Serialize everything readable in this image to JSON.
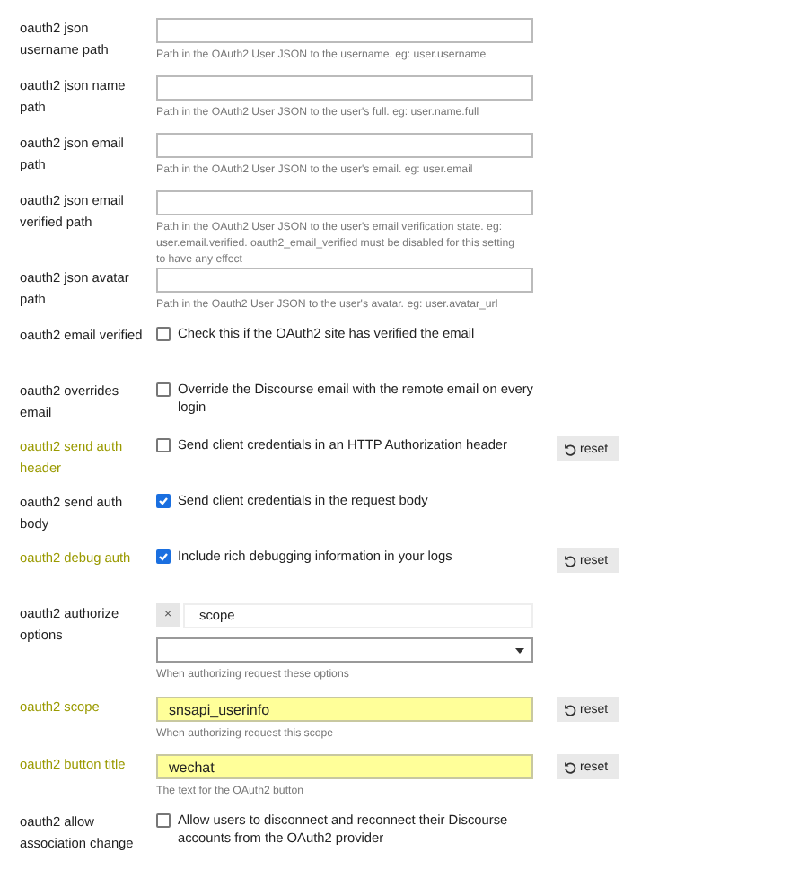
{
  "settings": [
    {
      "label": "oauth2 json username path",
      "kind": "text",
      "overridden": false,
      "description": "Path in the OAuth2 User JSON to the username. eg: user.username"
    },
    {
      "label": "oauth2 json name path",
      "kind": "text",
      "overridden": false,
      "description": "Path in the OAuth2 User JSON to the user's full. eg: user.name.full"
    },
    {
      "label": "oauth2 json email path",
      "kind": "text",
      "overridden": false,
      "description": "Path in the OAuth2 User JSON to the user's email. eg: user.email"
    },
    {
      "label": "oauth2 json email verified path",
      "kind": "text",
      "overridden": false,
      "description": "Path in the OAuth2 User JSON to the user's email verification state. eg: user.email.verified. oauth2_email_verified must be disabled for this setting to have any effect"
    },
    {
      "label": "oauth2 json avatar path",
      "kind": "text",
      "overridden": false,
      "description": "Path in the Oauth2 User JSON to the user's avatar. eg: user.avatar_url"
    },
    {
      "label": "oauth2 email verified",
      "kind": "checkbox",
      "overridden": false,
      "checked": false,
      "description": "Check this if the OAuth2 site has verified the email"
    },
    {
      "label": "oauth2 overrides email",
      "kind": "checkbox",
      "overridden": false,
      "checked": false,
      "description": "Override the Discourse email with the remote email on every login"
    },
    {
      "label": "oauth2 send auth header",
      "kind": "checkbox",
      "overridden": true,
      "checked": false,
      "description": "Send client credentials in an HTTP Authorization header",
      "reset_button": "reset"
    },
    {
      "label": "oauth2 send auth body",
      "kind": "checkbox",
      "overridden": false,
      "checked": true,
      "description": "Send client credentials in the request body"
    },
    {
      "label": "oauth2 debug auth",
      "kind": "checkbox",
      "overridden": true,
      "checked": true,
      "description": "Include rich debugging information in your logs",
      "reset_button": "reset"
    },
    {
      "label": "oauth2 authorize options",
      "kind": "list",
      "overridden": false,
      "tags": [
        {
          "remove": "×",
          "label": "scope"
        }
      ],
      "description": "When authorizing request these options"
    },
    {
      "label": "oauth2 scope",
      "kind": "text",
      "overridden": true,
      "value": "snsapi_userinfo",
      "description": "When authorizing request this scope",
      "reset_button": "reset"
    },
    {
      "label": "oauth2 button title",
      "kind": "text",
      "overridden": true,
      "value": "wechat",
      "description": "The text for the OAuth2 button",
      "reset_button": "reset"
    },
    {
      "label": "oauth2 allow association change",
      "kind": "checkbox",
      "overridden": false,
      "checked": false,
      "description": "Allow users to disconnect and reconnect their Discourse accounts from the OAuth2 provider"
    }
  ]
}
